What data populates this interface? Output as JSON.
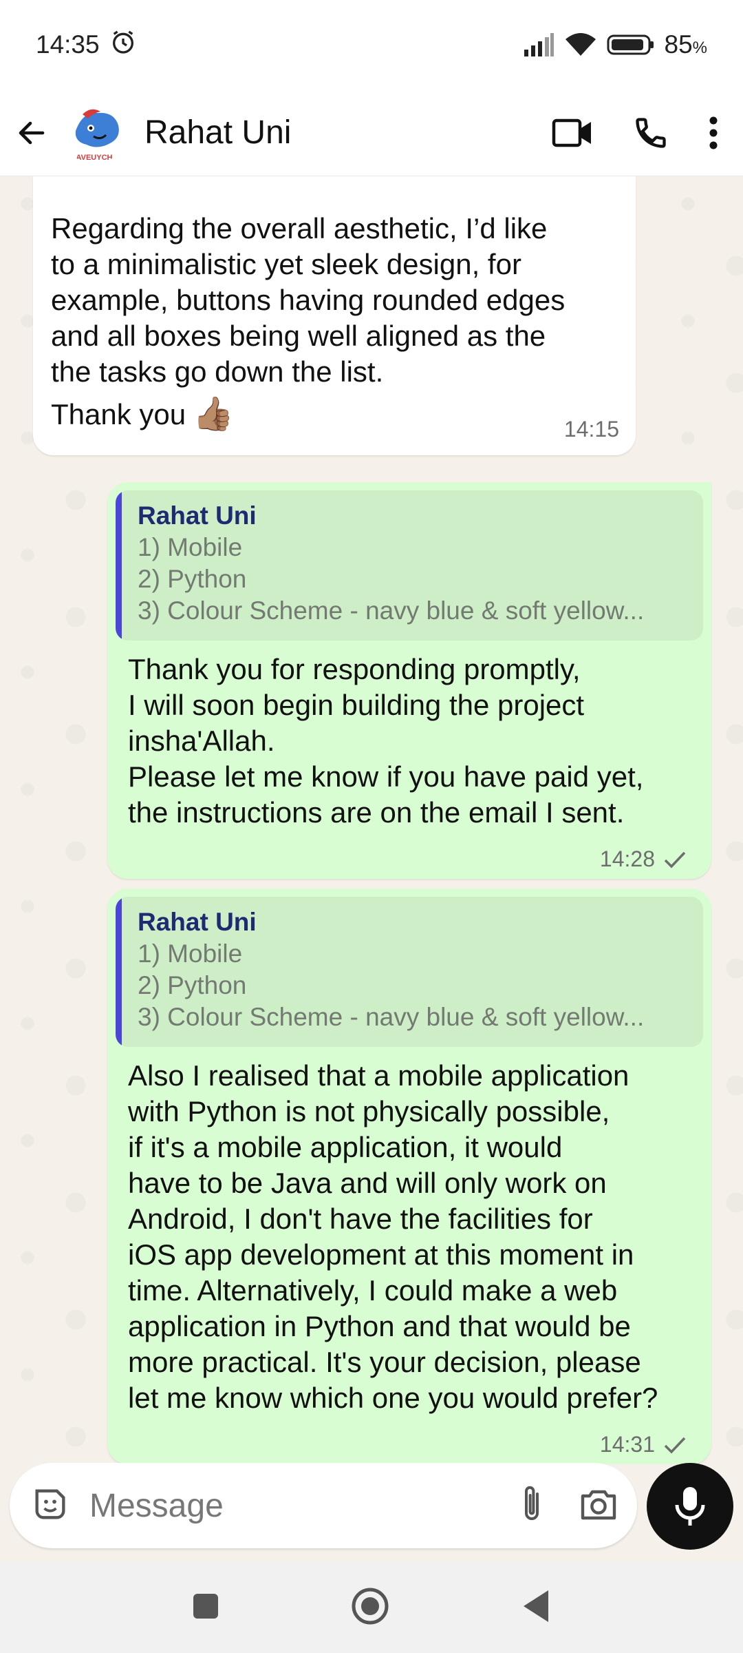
{
  "status_bar": {
    "time": "14:35",
    "battery": "85",
    "battery_unit": "%"
  },
  "header": {
    "contact_name": "Rahat Uni",
    "avatar_caption": "AVEUYCH"
  },
  "messages": {
    "incoming": {
      "lines": [
        "Regarding the overall aesthetic, I’d like",
        "to a minimalistic yet sleek design, for",
        "example, buttons having rounded edges",
        "and all boxes being well aligned as the",
        "the tasks go down the list."
      ],
      "closing": "Thank you",
      "emoji": "👍🏽",
      "time": "14:15"
    },
    "out1": {
      "quote_author": "Rahat Uni",
      "quote_lines": [
        "1) Mobile",
        "2) Python",
        "3) Colour Scheme - navy blue & soft yellow..."
      ],
      "lines": [
        "Thank you for responding promptly,",
        "I will soon begin building the project",
        "insha'Allah.",
        "Please let me know if you have paid yet,",
        "the instructions are on the email I sent."
      ],
      "time": "14:28"
    },
    "out2": {
      "quote_author": "Rahat Uni",
      "quote_lines": [
        "1) Mobile",
        "2) Python",
        "3) Colour Scheme - navy blue & soft yellow..."
      ],
      "lines": [
        "Also I realised that a mobile application",
        "with Python is not physically possible,",
        "if it's a mobile application, it would",
        "have to be Java and will only work on",
        "Android, I don't have the facilities for",
        "iOS app development at this moment in",
        "time. Alternatively, I could make a web",
        "application in Python and that would be",
        "more practical. It's your decision, please",
        "let me know which one you would prefer?"
      ],
      "time": "14:31"
    }
  },
  "composer": {
    "placeholder": "Message"
  },
  "colors": {
    "outgoing_bubble": "#d8fdd2",
    "quote_bar": "#4b45d8",
    "quote_author": "#1e2b72"
  }
}
